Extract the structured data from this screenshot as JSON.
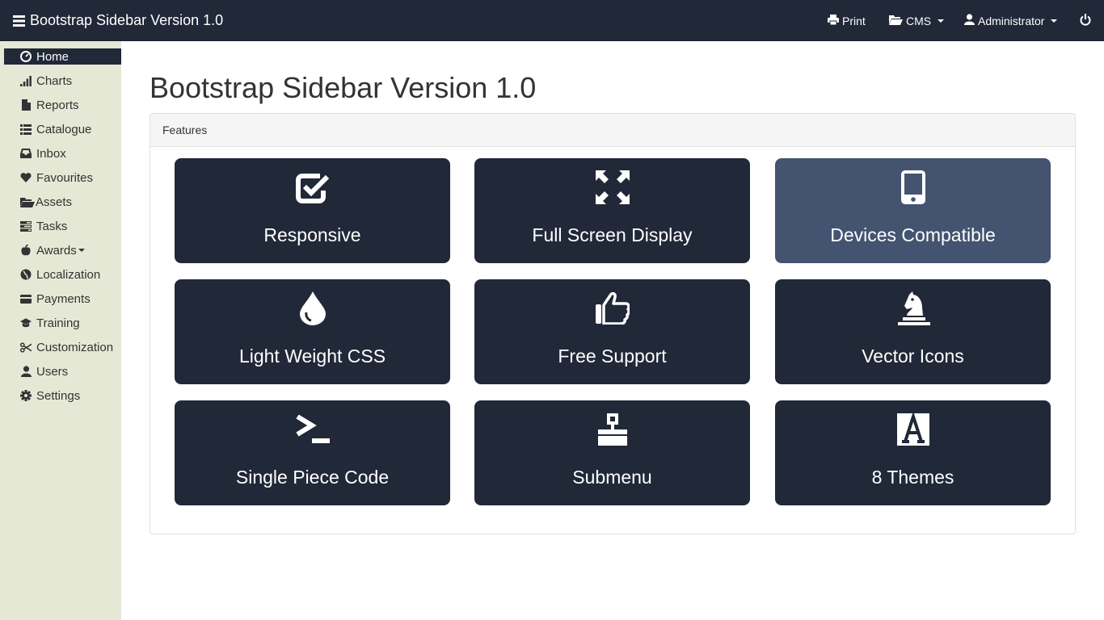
{
  "navbar": {
    "brand": "Bootstrap Sidebar Version 1.0",
    "print_label": "Print",
    "cms_label": "CMS",
    "admin_label": "Administrator"
  },
  "sidebar": {
    "items": [
      {
        "label": "Home",
        "icon": "dashboard-icon",
        "active": true
      },
      {
        "label": "Charts",
        "icon": "signal-icon"
      },
      {
        "label": "Reports",
        "icon": "file-icon"
      },
      {
        "label": "Catalogue",
        "icon": "th-list-icon"
      },
      {
        "label": "Inbox",
        "icon": "inbox-icon"
      },
      {
        "label": "Favourites",
        "icon": "heart-icon"
      },
      {
        "label": "Assets",
        "icon": "folder-open-icon"
      },
      {
        "label": "Tasks",
        "icon": "tasks-icon"
      },
      {
        "label": "Awards",
        "icon": "apple-icon",
        "has_dropdown": true
      },
      {
        "label": "Localization",
        "icon": "globe-icon"
      },
      {
        "label": "Payments",
        "icon": "credit-card-icon"
      },
      {
        "label": "Training",
        "icon": "education-icon"
      },
      {
        "label": "Customization",
        "icon": "scissors-icon"
      },
      {
        "label": "Users",
        "icon": "user-icon"
      },
      {
        "label": "Settings",
        "icon": "cog-icon"
      }
    ]
  },
  "main": {
    "title": "Bootstrap Sidebar Version 1.0",
    "panel_heading": "Features",
    "tiles": [
      {
        "label": "Responsive",
        "icon": "check-icon"
      },
      {
        "label": "Full Screen Display",
        "icon": "fullscreen-icon"
      },
      {
        "label": "Devices Compatible",
        "icon": "phone-icon",
        "highlighted": true
      },
      {
        "label": "Light Weight CSS",
        "icon": "tint-icon"
      },
      {
        "label": "Free Support",
        "icon": "thumbs-up-icon"
      },
      {
        "label": "Vector Icons",
        "icon": "knight-icon"
      },
      {
        "label": "Single Piece Code",
        "icon": "console-icon"
      },
      {
        "label": "Submenu",
        "icon": "sitemap-icon"
      },
      {
        "label": "8 Themes",
        "icon": "font-icon"
      }
    ]
  },
  "colors": {
    "navbar_bg": "#212838",
    "sidebar_bg": "#e5e8d5",
    "tile_bg": "#212838",
    "tile_highlight_bg": "#445370"
  }
}
